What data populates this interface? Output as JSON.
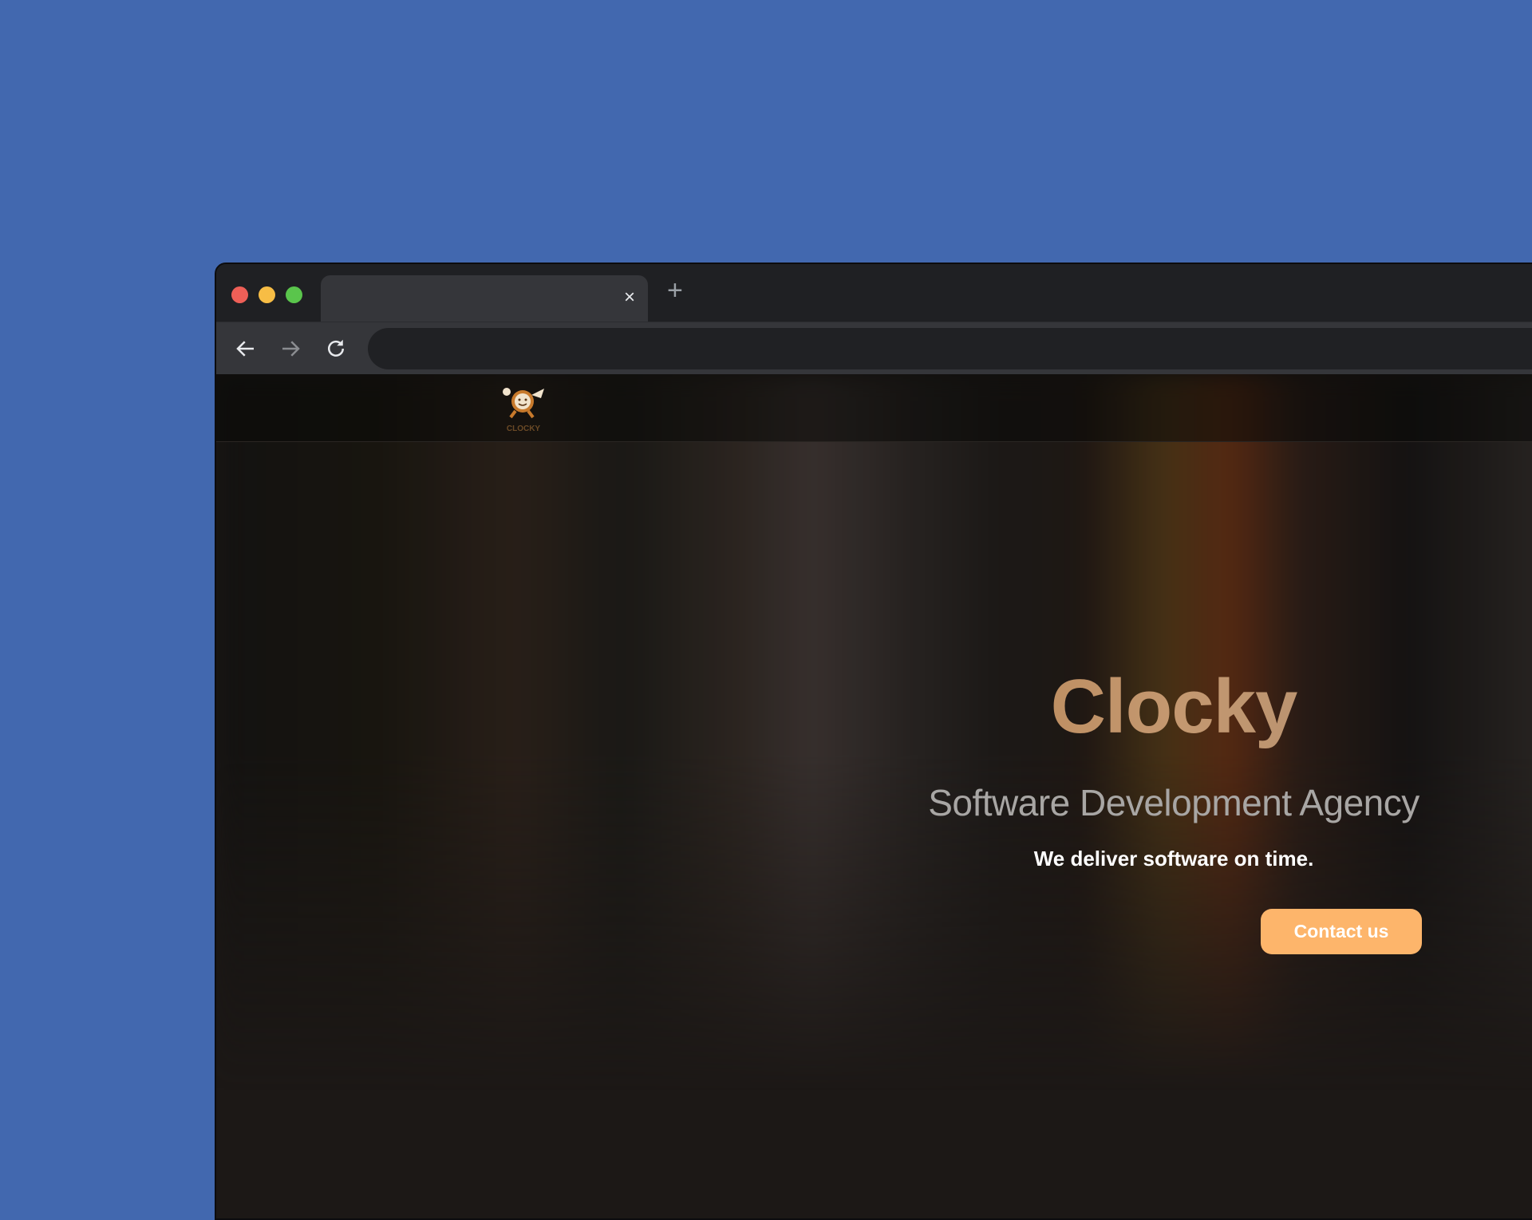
{
  "browser": {
    "tab_close_icon": "×",
    "new_tab_icon": "+",
    "traffic_lights": {
      "close": "#ee5f57",
      "minimize": "#f7bd45",
      "maximize": "#5ac54c"
    }
  },
  "site": {
    "logo_text": "CLOCKY",
    "hero": {
      "title": "Clocky",
      "subtitle": "Software Development Agency",
      "tagline": "We deliver software on time.",
      "cta_label": "Contact us"
    },
    "accent_color": "#fdb56b"
  }
}
